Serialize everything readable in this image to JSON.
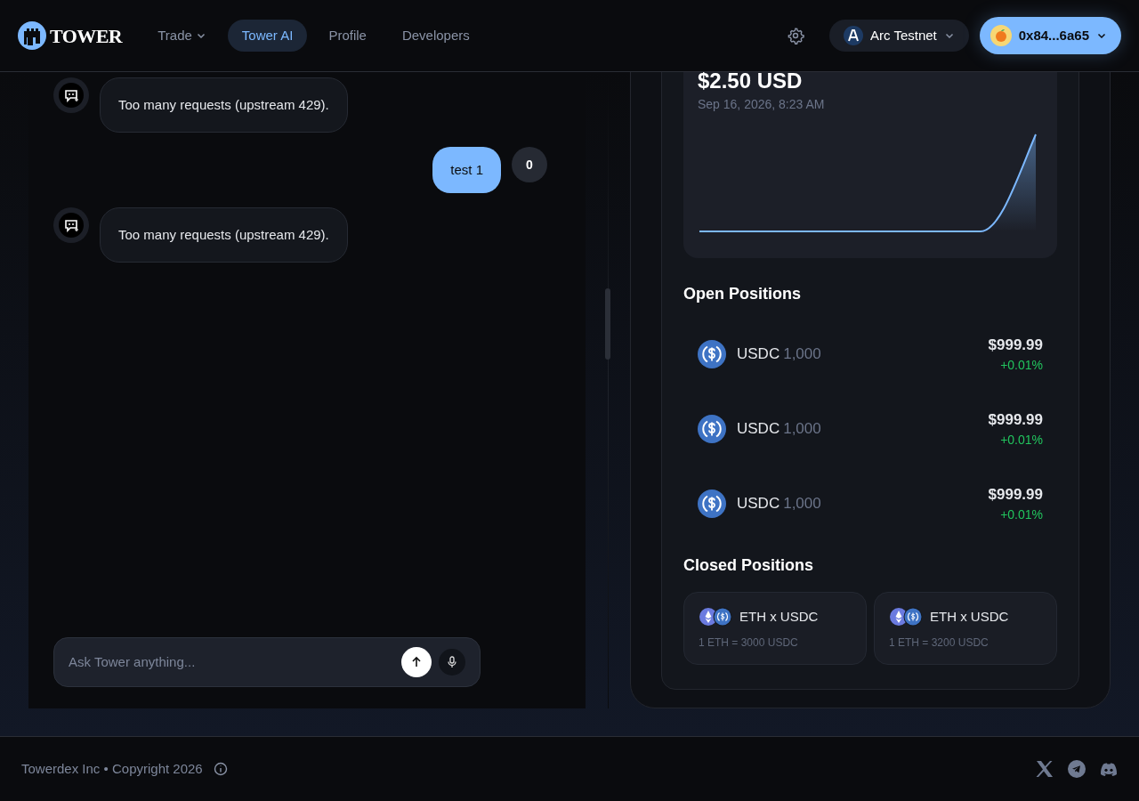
{
  "nav": {
    "logo": "TOWER",
    "items": [
      {
        "label": "Trade",
        "dropdown": true,
        "selected": false
      },
      {
        "label": "Tower AI",
        "dropdown": false,
        "selected": true
      },
      {
        "label": "Profile",
        "dropdown": false,
        "selected": false
      },
      {
        "label": "Developers",
        "dropdown": false,
        "selected": false
      }
    ],
    "network": "Arc Testnet",
    "wallet": "0x84...6a65"
  },
  "chat": {
    "messages": [
      {
        "kind": "assistant",
        "text": "Too many requests (upstream 429)."
      },
      {
        "kind": "user",
        "text": "test 1",
        "avatar": "0"
      },
      {
        "kind": "assistant",
        "text": "Too many requests (upstream 429)."
      }
    ],
    "input": {
      "placeholder": "Ask Tower anything..."
    }
  },
  "portfolio": {
    "value": "$2.50 USD",
    "timestamp": "Sep 16, 2026, 8:23 AM",
    "open_positions": {
      "title": "Open Positions",
      "items": [
        {
          "token": "USDC",
          "amount": "1,000",
          "value": "$999.99",
          "change": "+0.01%"
        },
        {
          "token": "USDC",
          "amount": "1,000",
          "value": "$999.99",
          "change": "+0.01%"
        },
        {
          "token": "USDC",
          "amount": "1,000",
          "value": "$999.99",
          "change": "+0.01%"
        }
      ]
    },
    "closed_positions": {
      "title": "Closed Positions",
      "items": [
        {
          "pair": "ETH x USDC",
          "rate": "1 ETH = 3000 USDC"
        },
        {
          "pair": "ETH x USDC",
          "rate": "1 ETH = 3200 USDC"
        }
      ]
    }
  },
  "footer": {
    "copyright": "Towerdex Inc • Copyright 2026"
  }
}
